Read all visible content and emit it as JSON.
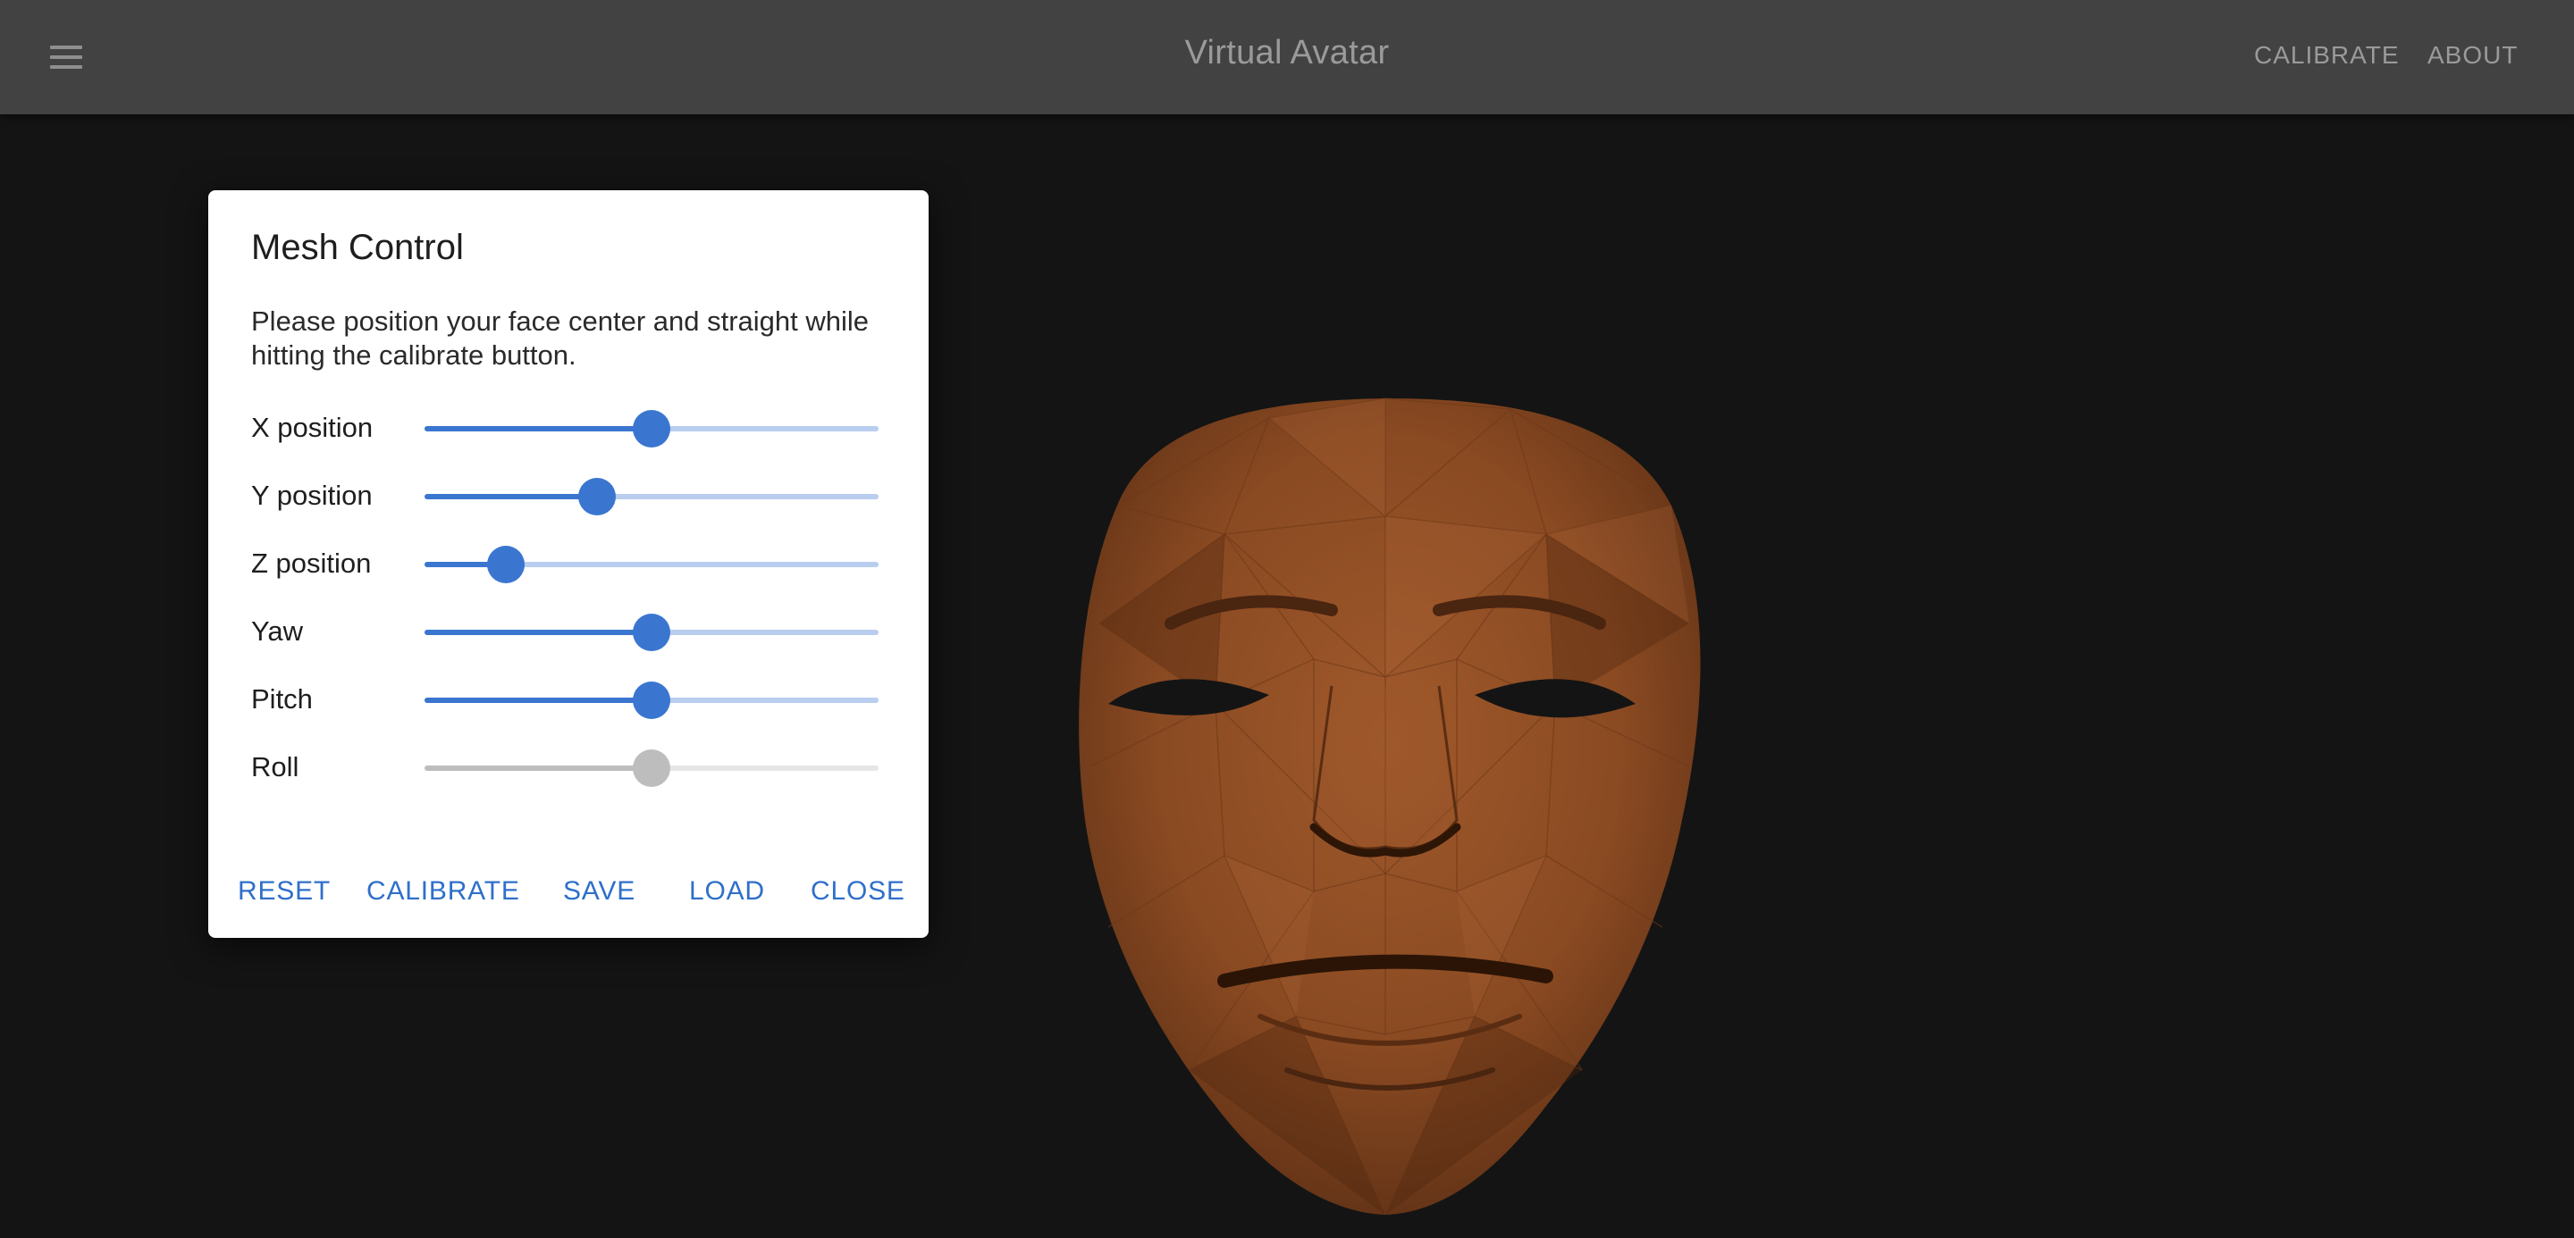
{
  "app": {
    "title": "Virtual Avatar",
    "nav": [
      "CALIBRATE",
      "ABOUT"
    ]
  },
  "icons": {
    "menu": "menu-icon",
    "face": "face-mesh"
  },
  "colors": {
    "appbar": "#424242",
    "background": "#141414",
    "accent": "#3a76d0",
    "mesh": "#8a4a22"
  },
  "dialog": {
    "title": "Mesh Control",
    "text": "Please position your face center and straight while hitting the calibrate button.",
    "sliders": [
      {
        "label": "X position",
        "value": 0.5,
        "disabled": false
      },
      {
        "label": "Y position",
        "value": 0.38,
        "disabled": false
      },
      {
        "label": "Z position",
        "value": 0.18,
        "disabled": false
      },
      {
        "label": "Yaw",
        "value": 0.5,
        "disabled": false
      },
      {
        "label": "Pitch",
        "value": 0.5,
        "disabled": false
      },
      {
        "label": "Roll",
        "value": 0.5,
        "disabled": true
      }
    ],
    "buttons": [
      "RESET",
      "CALIBRATE",
      "SAVE",
      "LOAD",
      "CLOSE"
    ]
  }
}
